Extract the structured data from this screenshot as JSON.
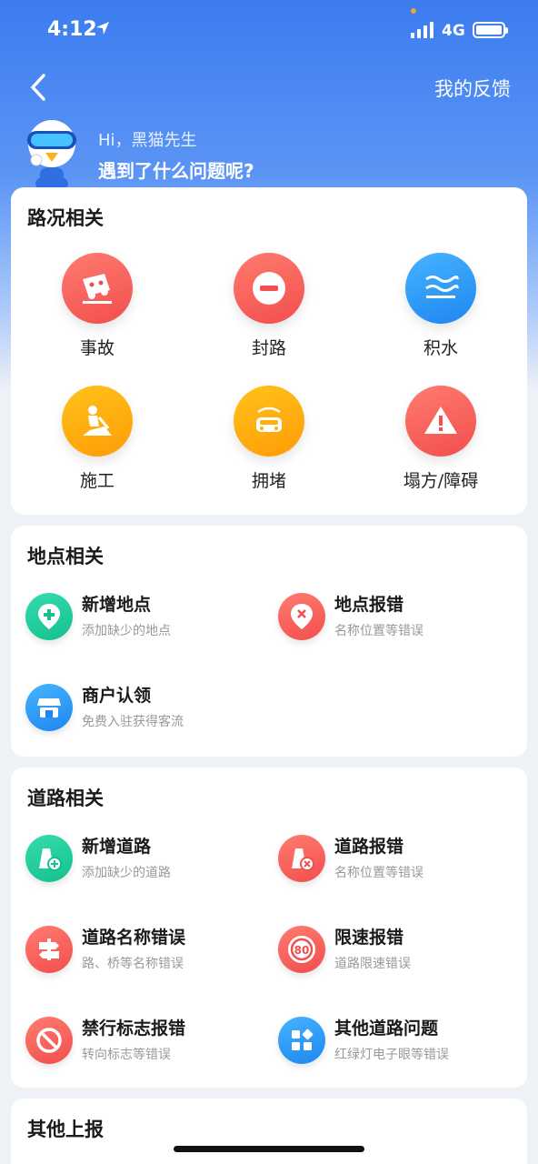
{
  "status_bar": {
    "time": "4:12",
    "network": "4G"
  },
  "header": {
    "feedback_label": "我的反馈",
    "greeting": "Hi，黑猫先生",
    "question": "遇到了什么问题呢?"
  },
  "road_conditions": {
    "title": "路况相关",
    "items": [
      {
        "label": "事故",
        "icon": "accident-car-icon"
      },
      {
        "label": "封路",
        "icon": "road-closed-icon"
      },
      {
        "label": "积水",
        "icon": "water-icon"
      },
      {
        "label": "施工",
        "icon": "construction-icon"
      },
      {
        "label": "拥堵",
        "icon": "traffic-jam-icon"
      },
      {
        "label": "塌方/障碍",
        "icon": "warning-icon"
      }
    ]
  },
  "place": {
    "title": "地点相关",
    "items": [
      {
        "title": "新增地点",
        "subtitle": "添加缺少的地点",
        "icon": "add-place-icon"
      },
      {
        "title": "地点报错",
        "subtitle": "名称位置等错误",
        "icon": "place-error-icon"
      },
      {
        "title": "商户认领",
        "subtitle": "免费入驻获得客流",
        "icon": "store-icon"
      }
    ]
  },
  "road": {
    "title": "道路相关",
    "items": [
      {
        "title": "新增道路",
        "subtitle": "添加缺少的道路",
        "icon": "add-road-icon"
      },
      {
        "title": "道路报错",
        "subtitle": "名称位置等错误",
        "icon": "road-error-icon"
      },
      {
        "title": "道路名称错误",
        "subtitle": "路、桥等名称错误",
        "icon": "signpost-icon"
      },
      {
        "title": "限速报错",
        "subtitle": "道路限速错误",
        "icon": "speed-limit-icon",
        "badge": "80"
      },
      {
        "title": "禁行标志报错",
        "subtitle": "转向标志等错误",
        "icon": "no-entry-icon"
      },
      {
        "title": "其他道路问题",
        "subtitle": "红绿灯电子眼等错误",
        "icon": "more-apps-icon"
      }
    ]
  },
  "other": {
    "title": "其他上报"
  },
  "colors": {
    "primary": "#3c7cf0",
    "red": "#f24e4e",
    "orange": "#ff9c06",
    "blue": "#1f86f0",
    "green": "#16c08e"
  }
}
